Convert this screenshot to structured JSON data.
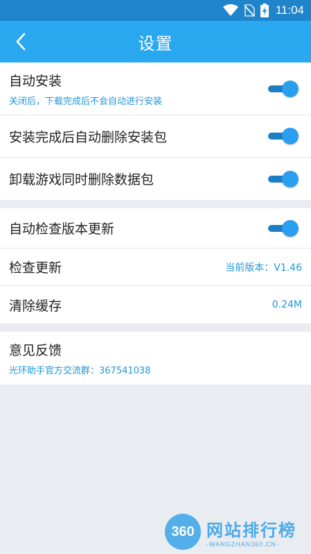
{
  "status_bar": {
    "time": "11:04"
  },
  "header": {
    "title": "设置"
  },
  "sections": [
    {
      "rows": [
        {
          "label": "自动安装",
          "sub": "关闭后，下载完成后不会自动进行安装",
          "toggle": true
        },
        {
          "label": "安装完成后自动删除安装包",
          "toggle": true
        },
        {
          "label": "卸载游戏同时删除数据包",
          "toggle": true
        }
      ]
    },
    {
      "rows": [
        {
          "label": "自动检查版本更新",
          "toggle": true
        },
        {
          "label": "检查更新",
          "value": "当前版本：V1.46"
        },
        {
          "label": "清除缓存",
          "value": "0.24M"
        }
      ]
    },
    {
      "rows": [
        {
          "label": "意见反馈",
          "sub": "光环助手官方交流群：367541038"
        }
      ]
    }
  ],
  "watermark": {
    "logo": "360",
    "cn": "网站排行榜",
    "en": "-WANGZHAN360.CN-"
  },
  "colors": {
    "accent": "#29a7ef",
    "statusbar": "#1f84c9",
    "link": "#1f96db"
  }
}
